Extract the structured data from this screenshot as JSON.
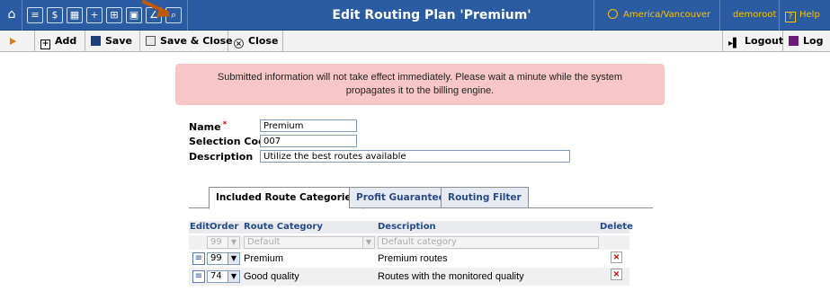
{
  "header": {
    "title": "Edit Routing Plan 'Premium'",
    "timezone": "America/Vancouver",
    "user": "demoroot",
    "help_label": "Help"
  },
  "top_icons": [
    "home-icon",
    "list-icon",
    "dollar-icon",
    "grid-icon",
    "plus-icon",
    "tree-icon",
    "folder-icon",
    "chart-icon",
    "search-icon"
  ],
  "toolbar": {
    "add_label": "Add",
    "save_label": "Save",
    "save_close_label": "Save & Close",
    "close_label": "Close",
    "logout_label": "Logout",
    "log_label": "Log"
  },
  "message": {
    "line1": "Submitted information will not take effect immediately. Please wait a minute while the system",
    "line2": "propagates it to the billing engine."
  },
  "form": {
    "name_label": "Name",
    "name_value": "Premium",
    "selection_code_label": "Selection Code",
    "selection_code_value": "007",
    "description_label": "Description",
    "description_value": "Utilize the best routes available"
  },
  "tabs": [
    {
      "label": "Included Route Categories",
      "active": true
    },
    {
      "label": "Profit Guarantee",
      "active": false
    },
    {
      "label": "Routing Filter",
      "active": false
    }
  ],
  "table": {
    "headers": {
      "edit": "Edit",
      "order": "Order",
      "route_category": "Route Category",
      "description": "Description",
      "delete": "Delete"
    },
    "default_row": {
      "order": "99",
      "category": "Default",
      "description": "Default category"
    },
    "rows": [
      {
        "order": "99",
        "category": "Premium",
        "description": "Premium routes"
      },
      {
        "order": "74",
        "category": "Good quality",
        "description": "Routes with the monitored quality"
      }
    ]
  },
  "colors": {
    "topbar": "#2a5ba3",
    "accent_yellow": "#f5c400",
    "message_bg": "#f7c6c6",
    "header_text": "#244a8a",
    "delete_red": "#d00000"
  }
}
